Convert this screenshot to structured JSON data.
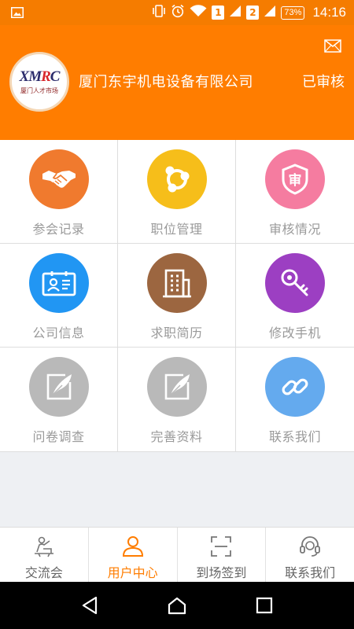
{
  "status_bar": {
    "sim1": "1",
    "sim2": "2",
    "battery": "73%",
    "time": "14:16"
  },
  "header": {
    "logo": {
      "text_main": "XMRC",
      "text_sub": "厦门人才市场"
    },
    "company_name": "厦门东宇机电设备有限公司",
    "audit_status": "已审核",
    "bg_color": "#ff7d00"
  },
  "grid": [
    {
      "label": "参会记录",
      "icon": "handshake-icon",
      "color": "#f07a2e"
    },
    {
      "label": "职位管理",
      "icon": "share-nodes-icon",
      "color": "#f6be1a"
    },
    {
      "label": "审核情况",
      "icon": "shield-check-icon",
      "color": "#f57ca0"
    },
    {
      "label": "公司信息",
      "icon": "id-card-icon",
      "color": "#2196f3"
    },
    {
      "label": "求职简历",
      "icon": "building-icon",
      "color": "#9c6640"
    },
    {
      "label": "修改手机",
      "icon": "key-icon",
      "color": "#9c3fc2"
    },
    {
      "label": "问卷调查",
      "icon": "edit-feather-icon",
      "color": "#b9b9b9"
    },
    {
      "label": "完善资料",
      "icon": "edit-feather-icon",
      "color": "#b9b9b9"
    },
    {
      "label": "联系我们",
      "icon": "link-icon",
      "color": "#64aaee"
    }
  ],
  "tabs": [
    {
      "label": "交流会",
      "icon": "presenter-icon",
      "active": false
    },
    {
      "label": "用户中心",
      "icon": "user-icon",
      "active": true
    },
    {
      "label": "到场签到",
      "icon": "scan-icon",
      "active": false
    },
    {
      "label": "联系我们",
      "icon": "headset-icon",
      "active": false
    }
  ],
  "colors": {
    "accent": "#ff7d00",
    "inactive_text": "#666666"
  }
}
